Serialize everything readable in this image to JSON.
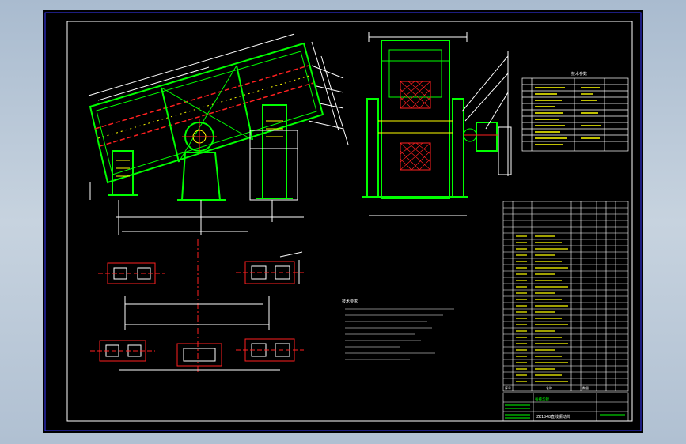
{
  "drawing": {
    "title_block_name": "ZK1848直线振动筛",
    "title_block_company": "张掖华锐",
    "table_header_seq": "序号",
    "table_header_name": "名称",
    "table_header_qty": "数量",
    "tech_params_title": "技术参数",
    "notes_title": "技术要求"
  },
  "colors": {
    "sheet": "#000000",
    "border": "#3a3aff",
    "frame": "#ffffff",
    "green": "#00ff00",
    "red": "#ff2020",
    "yellow": "#ffff00",
    "cyan": "#00ffff",
    "magenta": "#ff00ff"
  },
  "icons": [
    "dimension-arrow-icon",
    "hatch-pattern-icon"
  ]
}
